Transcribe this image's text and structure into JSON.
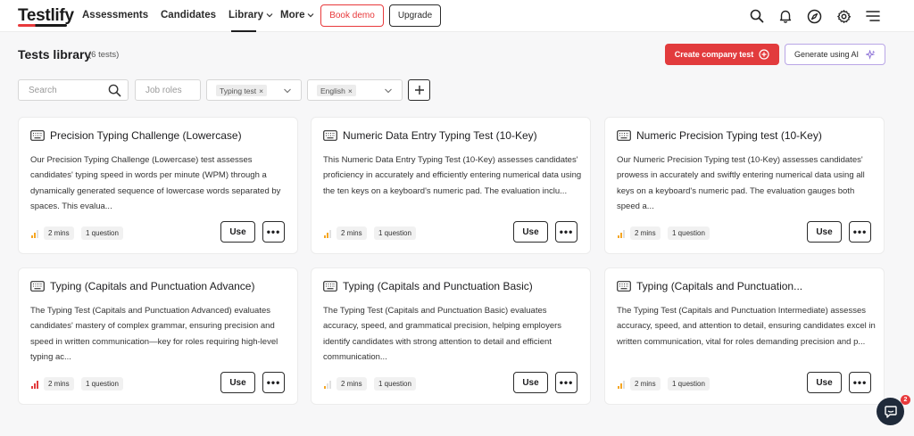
{
  "nav": {
    "logo": "Testlify",
    "links": [
      {
        "label": "Assessments"
      },
      {
        "label": "Candidates"
      },
      {
        "label": "Library"
      },
      {
        "label": "More"
      }
    ],
    "book_demo": "Book demo",
    "upgrade": "Upgrade",
    "icons": [
      "search-icon",
      "bell-icon",
      "compass-icon",
      "gear-icon",
      "menu-icon"
    ]
  },
  "header": {
    "title": "Tests library",
    "count": "(6 tests)",
    "create_button": "Create company test",
    "ai_button": "Generate using AI"
  },
  "filters": {
    "search_placeholder": "Search",
    "job_roles_placeholder": "Job roles",
    "type_chip": "Typing test",
    "language_chip": "English"
  },
  "colors": {
    "accent_red": "#e23b3d",
    "ai_border": "#b9a6e6",
    "signal_orange": "#f5a623",
    "signal_red": "#e23b3d"
  },
  "cards": [
    {
      "title": "Precision Typing Challenge (Lowercase)",
      "description": "Our Precision Typing Challenge (Lowercase) test assesses candidates' typing speed in words per minute (WPM) through a dynamically generated sequence of lowercase words separated by spaces. This evalua...",
      "time": "2 mins",
      "questions": "1 question",
      "level_bars": 2,
      "use_label": "Use"
    },
    {
      "title": "Numeric Data Entry Typing Test (10-Key)",
      "description": "This Numeric Data Entry Typing Test (10-Key) assesses candidates' proficiency in accurately and efficiently entering numerical data using the ten keys on a keyboard's numeric pad. The evaluation inclu...",
      "time": "2 mins",
      "questions": "1 question",
      "level_bars": 2,
      "use_label": "Use"
    },
    {
      "title": "Numeric Precision Typing test (10-Key)",
      "description": "Our Numeric Precision Typing test (10-Key) assesses candidates' prowess in accurately and swiftly entering numerical data using all keys on a keyboard's numeric pad. The evaluation gauges both speed a...",
      "time": "2 mins",
      "questions": "1 question",
      "level_bars": 2,
      "use_label": "Use"
    },
    {
      "title": "Typing (Capitals and Punctuation Advance)",
      "description": "The Typing Test (Capitals and Punctuation Advanced) evaluates candidates' mastery of complex grammar, ensuring precision and speed in written communication—key for roles requiring high-level typing ac...",
      "time": "2 mins",
      "questions": "1 question",
      "level_bars": 3,
      "use_label": "Use"
    },
    {
      "title": "Typing (Capitals and Punctuation Basic)",
      "description": "The Typing Test (Capitals and Punctuation Basic) evaluates accuracy, speed, and grammatical precision, helping employers identify candidates with strong attention to detail and efficient communication...",
      "time": "2 mins",
      "questions": "1 question",
      "level_bars": 1,
      "use_label": "Use"
    },
    {
      "title": "Typing (Capitals and Punctuation...",
      "description": "The Typing Test (Capitals and Punctuation Intermediate) assesses accuracy, speed, and attention to detail, ensuring candidates excel in written communication, vital for roles demanding precision and p...",
      "time": "2 mins",
      "questions": "1 question",
      "level_bars": 2,
      "use_label": "Use"
    }
  ],
  "chat": {
    "badge": "2"
  }
}
